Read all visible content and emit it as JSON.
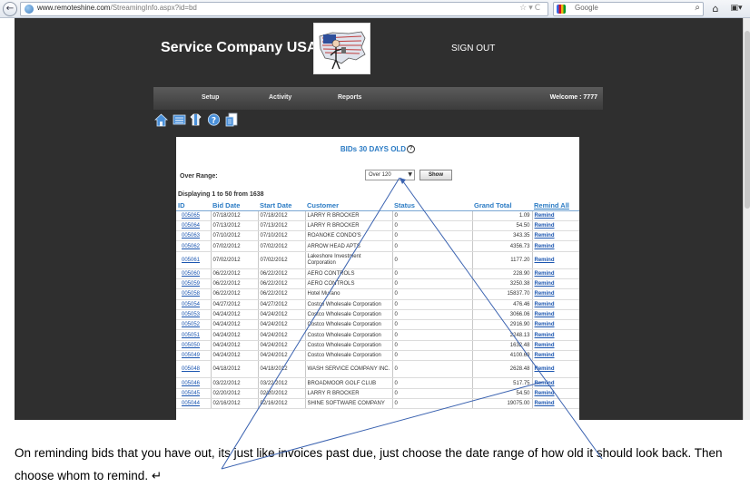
{
  "browser": {
    "url_domain": "www.remoteshine.com",
    "url_path": "/StreamingInfo.aspx?id=bd",
    "search_engine": "Google"
  },
  "site": {
    "title": "Service Company USA",
    "sign_out": "SIGN OUT",
    "menu": [
      "Setup",
      "Activity",
      "Reports"
    ],
    "welcome": "Welcome : 7777"
  },
  "panel": {
    "title": "BIDs 30 DAYS OLD",
    "help_glyph": "?",
    "over_range_label": "Over Range:",
    "range_selected": "Over 120",
    "show_label": "Show",
    "displaying": "Displaying 1 to 50 from 1638"
  },
  "table": {
    "headers": [
      "ID",
      "Bid Date",
      "Start Date",
      "Customer",
      "Status",
      "Grand Total",
      "Remind All"
    ],
    "remind_label": "Remind",
    "rows": [
      {
        "id": "005065",
        "bid_date": "07/18/2012",
        "start_date": "07/18/2012",
        "customer": "LARRY R BROCKER",
        "status": "0",
        "total": "1.09"
      },
      {
        "id": "005064",
        "bid_date": "07/13/2012",
        "start_date": "07/13/2012",
        "customer": "LARRY R BROCKER",
        "status": "0",
        "total": "54.50"
      },
      {
        "id": "005063",
        "bid_date": "07/10/2012",
        "start_date": "07/10/2012",
        "customer": "ROANOKE CONDO'S",
        "status": "0",
        "total": "343.35"
      },
      {
        "id": "005062",
        "bid_date": "07/02/2012",
        "start_date": "07/02/2012",
        "customer": "ARROW HEAD APTS",
        "status": "0",
        "total": "4356.73"
      },
      {
        "id": "005061",
        "bid_date": "07/02/2012",
        "start_date": "07/02/2012",
        "customer": "Lakeshore Investment Corporation",
        "status": "0",
        "total": "1177.20",
        "tall": true
      },
      {
        "id": "005060",
        "bid_date": "06/22/2012",
        "start_date": "06/22/2012",
        "customer": "AERO CONTROLS",
        "status": "0",
        "total": "228.90"
      },
      {
        "id": "005059",
        "bid_date": "06/22/2012",
        "start_date": "06/22/2012",
        "customer": "AERO CONTROLS",
        "status": "0",
        "total": "3250.38"
      },
      {
        "id": "005058",
        "bid_date": "06/22/2012",
        "start_date": "06/22/2012",
        "customer": "Hotel Murano",
        "status": "0",
        "total": "15837.70"
      },
      {
        "id": "005054",
        "bid_date": "04/27/2012",
        "start_date": "04/27/2012",
        "customer": "Costco Wholesale Corporation",
        "status": "0",
        "total": "476.46"
      },
      {
        "id": "005053",
        "bid_date": "04/24/2012",
        "start_date": "04/24/2012",
        "customer": "Costco Wholesale Corporation",
        "status": "0",
        "total": "3066.06"
      },
      {
        "id": "005052",
        "bid_date": "04/24/2012",
        "start_date": "04/24/2012",
        "customer": "Costco Wholesale Corporation",
        "status": "0",
        "total": "2916.90"
      },
      {
        "id": "005051",
        "bid_date": "04/24/2012",
        "start_date": "04/24/2012",
        "customer": "Costco Wholesale Corporation",
        "status": "0",
        "total": "2248.13"
      },
      {
        "id": "005050",
        "bid_date": "04/24/2012",
        "start_date": "04/24/2012",
        "customer": "Costco Wholesale Corporation",
        "status": "0",
        "total": "1632.48"
      },
      {
        "id": "005049",
        "bid_date": "04/24/2012",
        "start_date": "04/24/2012",
        "customer": "Costco Wholesale Corporation",
        "status": "0",
        "total": "4100.69"
      },
      {
        "id": "005048",
        "bid_date": "04/18/2012",
        "start_date": "04/18/2012",
        "customer": "WASH SERVICE COMPANY INC.",
        "status": "0",
        "total": "2628.48",
        "tall": true
      },
      {
        "id": "005046",
        "bid_date": "03/22/2012",
        "start_date": "03/22/2012",
        "customer": "BROADMOOR GOLF CLUB",
        "status": "0",
        "total": "517.75"
      },
      {
        "id": "005045",
        "bid_date": "02/20/2012",
        "start_date": "02/20/2012",
        "customer": "LARRY R BROCKER",
        "status": "0",
        "total": "54.50"
      },
      {
        "id": "005044",
        "bid_date": "02/16/2012",
        "start_date": "02/16/2012",
        "customer": "SHINE SOFTWARE COMPANY",
        "status": "0",
        "total": "19075.00"
      }
    ]
  },
  "caption": {
    "text": "On reminding bids that you have out, its just like invoices past due, just choose the date range of how old it should look back. Then choose whom to remind. ↵"
  },
  "icons": {
    "back": "back-arrow-icon",
    "toolbar": [
      "home-icon",
      "list-icon",
      "shirt-icon",
      "help-icon",
      "document-icon"
    ]
  },
  "colors": {
    "site_background": "#2f2f2f",
    "link_blue": "#1a55b0",
    "heading_blue": "#2b7bc4",
    "annotation_line": "#3a62b0"
  }
}
